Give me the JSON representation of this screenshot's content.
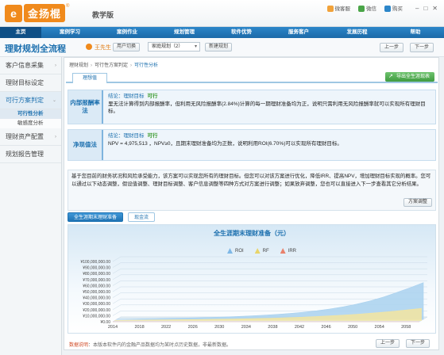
{
  "brand": {
    "logo_mark": "e",
    "logo_text": "金扬棍",
    "edition": "教学版"
  },
  "toplinks": [
    {
      "label": "微客服",
      "icon": "chat-icon",
      "color": "#f1a23a"
    },
    {
      "label": "微信",
      "icon": "wechat-icon",
      "color": "#4aa548"
    },
    {
      "label": "购买",
      "icon": "cart-icon",
      "color": "#2c86c9"
    }
  ],
  "nav": [
    "主页",
    "案例学习",
    "案例作业",
    "规划管理",
    "软件优势",
    "服务客户",
    "发展历程",
    "帮助"
  ],
  "title": {
    "app": "理财规划全流程",
    "user": "王先生",
    "switch_user": "用户切换",
    "plan_select": "家庭规划（2）",
    "new_plan": "新建规划",
    "prev": "上一步",
    "next": "下一步"
  },
  "sidebar": {
    "items": [
      {
        "label": "客户信息采集",
        "chev": "›"
      },
      {
        "label": "理财目标设定",
        "chev": ""
      },
      {
        "label": "可行方案判定",
        "chev": "⌄"
      },
      {
        "label": "理财资产配置",
        "chev": "›"
      },
      {
        "label": "规划报告管理",
        "chev": ""
      }
    ],
    "subs": [
      "可行性分析",
      "敏感度分析"
    ]
  },
  "crumbs": [
    "理财规划",
    "可行性方案判定",
    "可行性分析"
  ],
  "tab": "理想值",
  "export": "导出全生涯现表",
  "cards": [
    {
      "label": "内部报酬率法",
      "concl_prefix": "结论：理财目标",
      "verdict": "可行",
      "text": "里无法计算得到内部报酬率，但利用无风险报酬率(2.84%)计算的每一期理财准备均为正，说明只需利用无风险报酬率就可以实现所有理财目标。"
    },
    {
      "label": "净现值法",
      "concl_prefix": "结论：理财目标",
      "verdict": "可行",
      "text": "NPV = 4,975,513 ，NPV≥0，且期末理财准备均为正数，说明利用ROI(6.70%)可以实现所有理财目标。"
    }
  ],
  "advice": {
    "text": "基于您目前的财务状况和风险承受能力，该方案可以实现您所有的理财目标。但您可以对该方案进行优化，降低IRR、提高NPV，增加理财目标实现的概率。您可以通过以下动态调整，假设值调整、理财目标调整、客户信息调整等四种方式对方案进行调整；如果放弃调整，您也可以直接进入下一步查看其它分析结果。",
    "button": "方案调整"
  },
  "chart_tabs": [
    "全生涯期末理财准备",
    "现金流"
  ],
  "chart_data": {
    "type": "area",
    "title": "全生涯期末理财准备（元）",
    "xlabel": "",
    "ylabel": "",
    "x": [
      2014,
      2016,
      2018,
      2020,
      2022,
      2024,
      2026,
      2028,
      2030,
      2032,
      2034,
      2036,
      2038,
      2040,
      2042,
      2044,
      2046,
      2048,
      2050,
      2052,
      2054,
      2056,
      2058,
      2060
    ],
    "x_ticks": [
      "2014",
      "2018",
      "2022",
      "2026",
      "2030",
      "2034",
      "2038",
      "2042",
      "2046",
      "2050",
      "2054",
      "2058"
    ],
    "y_ticks": [
      "¥0.00",
      "¥10,000,000.00",
      "¥20,000,000.00",
      "¥30,000,000.00",
      "¥40,000,000.00",
      "¥50,000,000.00",
      "¥60,000,000.00",
      "¥70,000,000.00",
      "¥80,000,000.00",
      "¥90,000,000.00",
      "¥100,000,000.00"
    ],
    "ylim": [
      0,
      100000000
    ],
    "grid": true,
    "legend_position": "top",
    "series": [
      {
        "name": "ROI",
        "color": "#a9d1ef",
        "values": [
          200000,
          500000,
          900000,
          1300000,
          1700000,
          2100000,
          2600000,
          3200000,
          3900000,
          4700000,
          5700000,
          6800000,
          8200000,
          9800000,
          11800000,
          14200000,
          17200000,
          20800000,
          25200000,
          30600000,
          37000000,
          44500000,
          52500000,
          61000000
        ]
      },
      {
        "name": "RF",
        "color": "#f3e5a0",
        "values": [
          150000,
          350000,
          600000,
          850000,
          1100000,
          1350000,
          1600000,
          1900000,
          2200000,
          2600000,
          3000000,
          3500000,
          4100000,
          4800000,
          5600000,
          6500000,
          7600000,
          8800000,
          10200000,
          11800000,
          13600000,
          15600000,
          17800000,
          20200000
        ]
      },
      {
        "name": "IRR",
        "color": "#f4b6a8",
        "values": [
          0,
          0,
          0,
          0,
          0,
          0,
          0,
          0,
          0,
          0,
          0,
          0,
          0,
          0,
          0,
          0,
          0,
          0,
          0,
          0,
          0,
          0,
          0,
          0
        ]
      }
    ]
  },
  "footnote": {
    "label": "数据说明",
    "text": "：本版本软件内的金融产品数据均为某时点历史数据，非最新数据。"
  },
  "pager": {
    "prev": "上一步",
    "next": "下一步"
  },
  "window_controls": [
    "–",
    "□",
    "✕"
  ]
}
